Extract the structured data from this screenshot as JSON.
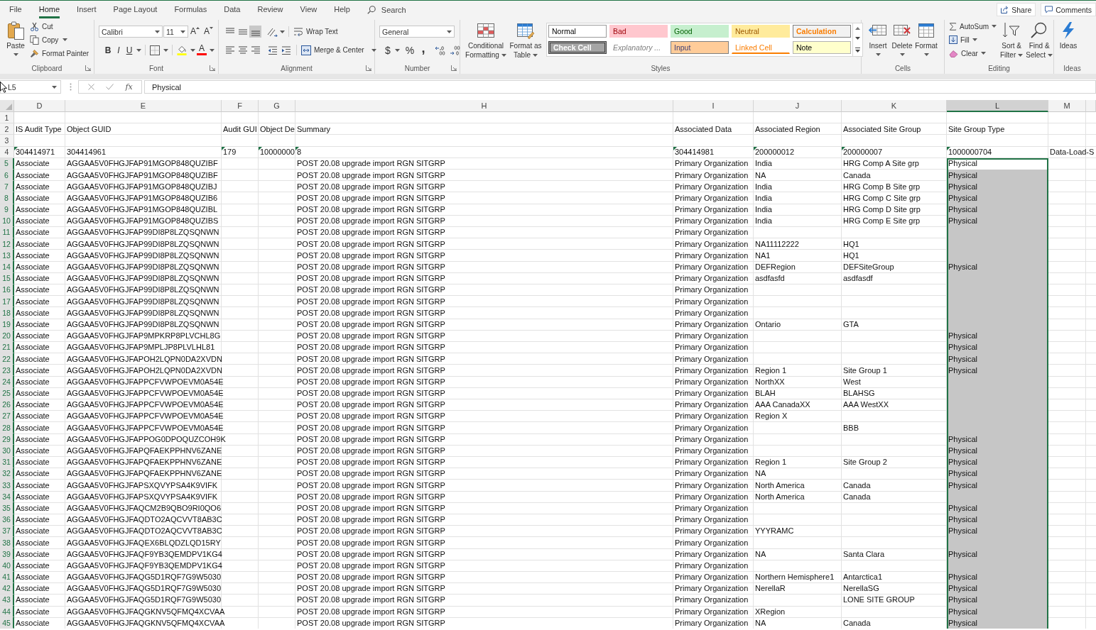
{
  "ribbon_tabs": [
    {
      "label": "File",
      "selected": false
    },
    {
      "label": "Home",
      "selected": true
    },
    {
      "label": "Insert",
      "selected": false
    },
    {
      "label": "Page Layout",
      "selected": false
    },
    {
      "label": "Formulas",
      "selected": false
    },
    {
      "label": "Data",
      "selected": false
    },
    {
      "label": "Review",
      "selected": false
    },
    {
      "label": "View",
      "selected": false
    },
    {
      "label": "Help",
      "selected": false
    }
  ],
  "search": {
    "placeholder": "Search"
  },
  "share_button": "Share",
  "comments_button": "Comments",
  "clipboard": {
    "label": "Clipboard",
    "launcher": true,
    "paste": "Paste",
    "cut": "Cut",
    "copy": "Copy",
    "format_painter": "Format Painter"
  },
  "font": {
    "label": "Font",
    "launcher": true,
    "font_name": "Calibri",
    "font_size": "11",
    "grow": "A",
    "shrink": "A",
    "bold": "B",
    "italic": "I",
    "underline": "U",
    "color_buttons": [
      {
        "kind": "fill",
        "color": "#ffff00"
      },
      {
        "kind": "text",
        "letter": "A",
        "color": "#ff0000"
      }
    ]
  },
  "alignment": {
    "label": "Alignment",
    "launcher": true,
    "vertical": [
      {
        "kind": "top",
        "selected": false
      },
      {
        "kind": "middle",
        "selected": false
      },
      {
        "kind": "bottom",
        "selected": true
      }
    ],
    "horizontal": [
      {
        "kind": "left",
        "selected": false
      },
      {
        "kind": "center",
        "selected": false
      },
      {
        "kind": "right",
        "selected": false
      }
    ],
    "wrap_text": "Wrap Text",
    "merge_center": "Merge & Center"
  },
  "number": {
    "label": "Number",
    "launcher": true,
    "format": "General",
    "currency": "$",
    "percent": "%",
    "comma": ","
  },
  "styles": {
    "label": "Styles",
    "conditional_formatting": "Conditional Formatting",
    "format_as_table": "Format as Table",
    "gallery": [
      {
        "label": "Normal",
        "kind": "normal",
        "color": "#ffffff"
      },
      {
        "label": "Bad",
        "kind": "bad",
        "color": "#ffc7ce"
      },
      {
        "label": "Good",
        "kind": "good",
        "color": "#c6efce"
      },
      {
        "label": "Neutral",
        "kind": "neutral",
        "color": "#ffeb9c"
      },
      {
        "label": "Calculation",
        "kind": "calculation",
        "color": "#f2f2f2"
      },
      {
        "label": "Check Cell",
        "kind": "check",
        "color": "#a5a5a5"
      },
      {
        "label": "Explanatory ...",
        "kind": "explanatory",
        "color": "#ffffff"
      },
      {
        "label": "Input",
        "kind": "input",
        "color": "#ffcc99"
      },
      {
        "label": "Linked Cell",
        "kind": "linked",
        "color": "#ffffff"
      },
      {
        "label": "Note",
        "kind": "note",
        "color": "#ffffcc"
      }
    ]
  },
  "cells": {
    "label": "Cells",
    "buttons": [
      {
        "label": "Insert",
        "kind": "insert"
      },
      {
        "label": "Delete",
        "kind": "delete"
      },
      {
        "label": "Format",
        "kind": "format"
      }
    ]
  },
  "editing": {
    "label": "Editing",
    "autosum": "AutoSum",
    "fill": "Fill",
    "clear": "Clear",
    "sort_filter": "Sort & Filter",
    "find_select": "Find & Select"
  },
  "ideas": {
    "label": "Ideas",
    "button": "Ideas"
  },
  "formula_bar": {
    "name_box": "L5",
    "insert_function": "fx",
    "formula": "Physical"
  },
  "sheet": {
    "columns": [
      {
        "letter": "D",
        "selected": false
      },
      {
        "letter": "E",
        "selected": false
      },
      {
        "letter": "F",
        "selected": false
      },
      {
        "letter": "G",
        "selected": false
      },
      {
        "letter": "H",
        "selected": false
      },
      {
        "letter": "I",
        "selected": false
      },
      {
        "letter": "J",
        "selected": false
      },
      {
        "letter": "K",
        "selected": false
      },
      {
        "letter": "L",
        "selected": true
      },
      {
        "letter": "M",
        "selected": false
      }
    ],
    "rows": [
      {
        "number": "1",
        "selected": false
      },
      {
        "number": "2",
        "selected": false,
        "is_audit_type": "IS Audit Type",
        "object_guid": "Object GUID",
        "audit_gui": "Audit GUI",
        "object_de": "Object De",
        "summary": "Summary",
        "associated_data": "Associated Data",
        "associated_region": "Associated Region",
        "associated_site_group": "Associated Site Group",
        "site_group_type": "Site Group Type"
      },
      {
        "number": "3",
        "selected": false
      },
      {
        "number": "4",
        "selected": false,
        "is_audit_type": "304414971",
        "object_guid": "304414961",
        "audit_gui": "179",
        "object_de": "10000000",
        "summary": "8",
        "associated_data": "304414981",
        "associated_region": "200000012",
        "associated_site_group": "200000007",
        "site_group_type": "1000000704",
        "column_10": "Data-Load-S",
        "flagged": {
          "is_audit_type": true,
          "object_guid": false,
          "audit_gui": true,
          "object_de": true,
          "summary": true,
          "associated_data": true,
          "associated_region": true,
          "associated_site_group": true,
          "site_group_type": true,
          "column_10": false
        }
      },
      {
        "number": "5",
        "selected": true,
        "is_audit_type": "Associate",
        "object_guid": "AGGAA5V0FHGJFAP91MGOP848QUZIBF",
        "summary": "POST 20.08 upgrade import RGN SITGRP",
        "associated_data": "Primary Organization",
        "associated_region": "India",
        "associated_site_group": "HRG Comp A Site grp",
        "site_group_type": "Physical"
      },
      {
        "number": "6",
        "selected": true,
        "is_audit_type": "Associate",
        "object_guid": "AGGAA5V0FHGJFAP91MGOP848QUZIBF",
        "summary": "POST 20.08 upgrade import RGN SITGRP",
        "associated_data": "Primary Organization",
        "associated_region": "NA",
        "associated_site_group": "Canada",
        "site_group_type": "Physical"
      },
      {
        "number": "7",
        "selected": true,
        "is_audit_type": "Associate",
        "object_guid": "AGGAA5V0FHGJFAP91MGOP848QUZIBJ",
        "summary": "POST 20.08 upgrade import RGN SITGRP",
        "associated_data": "Primary Organization",
        "associated_region": "India",
        "associated_site_group": "HRG Comp B Site grp",
        "site_group_type": "Physical"
      },
      {
        "number": "8",
        "selected": true,
        "is_audit_type": "Associate",
        "object_guid": "AGGAA5V0FHGJFAP91MGOP848QUZIB6",
        "summary": "POST 20.08 upgrade import RGN SITGRP",
        "associated_data": "Primary Organization",
        "associated_region": "India",
        "associated_site_group": "HRG Comp C Site grp",
        "site_group_type": "Physical"
      },
      {
        "number": "9",
        "selected": true,
        "is_audit_type": "Associate",
        "object_guid": "AGGAA5V0FHGJFAP91MGOP848QUZIBL",
        "summary": "POST 20.08 upgrade import RGN SITGRP",
        "associated_data": "Primary Organization",
        "associated_region": "India",
        "associated_site_group": "HRG Comp D Site grp",
        "site_group_type": "Physical"
      },
      {
        "number": "10",
        "selected": true,
        "is_audit_type": "Associate",
        "object_guid": "AGGAA5V0FHGJFAP91MGOP848QUZIBS",
        "summary": "POST 20.08 upgrade import RGN SITGRP",
        "associated_data": "Primary Organization",
        "associated_region": "India",
        "associated_site_group": "HRG Comp E Site grp",
        "site_group_type": "Physical"
      },
      {
        "number": "11",
        "selected": true,
        "is_audit_type": "Associate",
        "object_guid": "AGGAA5V0FHGJFAP99DI8P8LZQSQNWN",
        "summary": "POST 20.08 upgrade import RGN SITGRP",
        "associated_data": "Primary Organization"
      },
      {
        "number": "12",
        "selected": true,
        "is_audit_type": "Associate",
        "object_guid": "AGGAA5V0FHGJFAP99DI8P8LZQSQNWN",
        "summary": "POST 20.08 upgrade import RGN SITGRP",
        "associated_data": "Primary Organization",
        "associated_region": "NA11112222",
        "associated_site_group": "HQ1"
      },
      {
        "number": "13",
        "selected": true,
        "is_audit_type": "Associate",
        "object_guid": "AGGAA5V0FHGJFAP99DI8P8LZQSQNWN",
        "summary": "POST 20.08 upgrade import RGN SITGRP",
        "associated_data": "Primary Organization",
        "associated_region": "NA1",
        "associated_site_group": "HQ1"
      },
      {
        "number": "14",
        "selected": true,
        "is_audit_type": "Associate",
        "object_guid": "AGGAA5V0FHGJFAP99DI8P8LZQSQNWN",
        "summary": "POST 20.08 upgrade import RGN SITGRP",
        "associated_data": "Primary Organization",
        "associated_region": "DEFRegion",
        "associated_site_group": "DEFSiteGroup",
        "site_group_type": "Physical"
      },
      {
        "number": "15",
        "selected": true,
        "is_audit_type": "Associate",
        "object_guid": "AGGAA5V0FHGJFAP99DI8P8LZQSQNWN",
        "summary": "POST 20.08 upgrade import RGN SITGRP",
        "associated_data": "Primary Organization",
        "associated_region": "asdfasfd",
        "associated_site_group": "asdfasdf"
      },
      {
        "number": "16",
        "selected": true,
        "is_audit_type": "Associate",
        "object_guid": "AGGAA5V0FHGJFAP99DI8P8LZQSQNWN",
        "summary": "POST 20.08 upgrade import RGN SITGRP",
        "associated_data": "Primary Organization"
      },
      {
        "number": "17",
        "selected": true,
        "is_audit_type": "Associate",
        "object_guid": "AGGAA5V0FHGJFAP99DI8P8LZQSQNWN",
        "summary": "POST 20.08 upgrade import RGN SITGRP",
        "associated_data": "Primary Organization"
      },
      {
        "number": "18",
        "selected": true,
        "is_audit_type": "Associate",
        "object_guid": "AGGAA5V0FHGJFAP99DI8P8LZQSQNWN",
        "summary": "POST 20.08 upgrade import RGN SITGRP",
        "associated_data": "Primary Organization"
      },
      {
        "number": "19",
        "selected": true,
        "is_audit_type": "Associate",
        "object_guid": "AGGAA5V0FHGJFAP99DI8P8LZQSQNWN",
        "summary": "POST 20.08 upgrade import RGN SITGRP",
        "associated_data": "Primary Organization",
        "associated_region": "Ontario",
        "associated_site_group": "GTA"
      },
      {
        "number": "20",
        "selected": true,
        "is_audit_type": "Associate",
        "object_guid": "AGGAA5V0FHGJFAP9MPKRP8PLVCHL8G",
        "summary": "POST 20.08 upgrade import RGN SITGRP",
        "associated_data": "Primary Organization",
        "site_group_type": "Physical"
      },
      {
        "number": "21",
        "selected": true,
        "is_audit_type": "Associate",
        "object_guid": "AGGAA5V0FHGJFAP9MPLJP8PLVLHL81",
        "summary": "POST 20.08 upgrade import RGN SITGRP",
        "associated_data": "Primary Organization",
        "site_group_type": "Physical"
      },
      {
        "number": "22",
        "selected": true,
        "is_audit_type": "Associate",
        "object_guid": "AGGAA5V0FHGJFAPOH2LQPN0DA2XVDN",
        "summary": "POST 20.08 upgrade import RGN SITGRP",
        "associated_data": "Primary Organization",
        "site_group_type": "Physical"
      },
      {
        "number": "23",
        "selected": true,
        "is_audit_type": "Associate",
        "object_guid": "AGGAA5V0FHGJFAPOH2LQPN0DA2XVDN",
        "summary": "POST 20.08 upgrade import RGN SITGRP",
        "associated_data": "Primary Organization",
        "associated_region": "Region 1",
        "associated_site_group": "Site Group 1",
        "site_group_type": "Physical"
      },
      {
        "number": "24",
        "selected": true,
        "is_audit_type": "Associate",
        "object_guid": "AGGAA5V0FHGJFAPPCFVWPOEVM0A54E",
        "summary": "POST 20.08 upgrade import RGN SITGRP",
        "associated_data": "Primary Organization",
        "associated_region": "NorthXX",
        "associated_site_group": "West"
      },
      {
        "number": "25",
        "selected": true,
        "is_audit_type": "Associate",
        "object_guid": "AGGAA5V0FHGJFAPPCFVWPOEVM0A54E",
        "summary": "POST 20.08 upgrade import RGN SITGRP",
        "associated_data": "Primary Organization",
        "associated_region": "BLAH",
        "associated_site_group": "BLAHSG"
      },
      {
        "number": "26",
        "selected": true,
        "is_audit_type": "Associate",
        "object_guid": "AGGAA5V0FHGJFAPPCFVWPOEVM0A54E",
        "summary": "POST 20.08 upgrade import RGN SITGRP",
        "associated_data": "Primary Organization",
        "associated_region": "AAA CanadaXX",
        "associated_site_group": "AAA WestXX"
      },
      {
        "number": "27",
        "selected": true,
        "is_audit_type": "Associate",
        "object_guid": "AGGAA5V0FHGJFAPPCFVWPOEVM0A54E",
        "summary": "POST 20.08 upgrade import RGN SITGRP",
        "associated_data": "Primary Organization",
        "associated_region": "Region X"
      },
      {
        "number": "28",
        "selected": true,
        "is_audit_type": "Associate",
        "object_guid": "AGGAA5V0FHGJFAPPCFVWPOEVM0A54E",
        "summary": "POST 20.08 upgrade import RGN SITGRP",
        "associated_data": "Primary Organization",
        "associated_site_group": "BBB"
      },
      {
        "number": "29",
        "selected": true,
        "is_audit_type": "Associate",
        "object_guid": "AGGAA5V0FHGJFAPPOG0DPOQUZCOH9K",
        "summary": "POST 20.08 upgrade import RGN SITGRP",
        "associated_data": "Primary Organization",
        "site_group_type": "Physical"
      },
      {
        "number": "30",
        "selected": true,
        "is_audit_type": "Associate",
        "object_guid": "AGGAA5V0FHGJFAPQFAEKPPHNV6ZANE",
        "summary": "POST 20.08 upgrade import RGN SITGRP",
        "associated_data": "Primary Organization",
        "site_group_type": "Physical"
      },
      {
        "number": "31",
        "selected": true,
        "is_audit_type": "Associate",
        "object_guid": "AGGAA5V0FHGJFAPQFAEKPPHNV6ZANE",
        "summary": "POST 20.08 upgrade import RGN SITGRP",
        "associated_data": "Primary Organization",
        "associated_region": "Region 1",
        "associated_site_group": "Site Group 2",
        "site_group_type": "Physical"
      },
      {
        "number": "32",
        "selected": true,
        "is_audit_type": "Associate",
        "object_guid": "AGGAA5V0FHGJFAPQFAEKPPHNV6ZANE",
        "summary": "POST 20.08 upgrade import RGN SITGRP",
        "associated_data": "Primary Organization",
        "associated_region": "NA",
        "site_group_type": "Physical"
      },
      {
        "number": "33",
        "selected": true,
        "is_audit_type": "Associate",
        "object_guid": "AGGAA5V0FHGJFAPSXQVYPSA4K9VIFK",
        "summary": "POST 20.08 upgrade import RGN SITGRP",
        "associated_data": "Primary Organization",
        "associated_region": "North America",
        "associated_site_group": "Canada",
        "site_group_type": "Physical"
      },
      {
        "number": "34",
        "selected": true,
        "is_audit_type": "Associate",
        "object_guid": "AGGAA5V0FHGJFAPSXQVYPSA4K9VIFK",
        "summary": "POST 20.08 upgrade import RGN SITGRP",
        "associated_data": "Primary Organization",
        "associated_region": "North America",
        "associated_site_group": "Canada"
      },
      {
        "number": "35",
        "selected": true,
        "is_audit_type": "Associate",
        "object_guid": "AGGAA5V0FHGJFAQCM2B9QBO9RI0QO6",
        "summary": "POST 20.08 upgrade import RGN SITGRP",
        "associated_data": "Primary Organization",
        "site_group_type": "Physical"
      },
      {
        "number": "36",
        "selected": true,
        "is_audit_type": "Associate",
        "object_guid": "AGGAA5V0FHGJFAQDTO2AQCVVT8AB3C",
        "summary": "POST 20.08 upgrade import RGN SITGRP",
        "associated_data": "Primary Organization",
        "site_group_type": "Physical"
      },
      {
        "number": "37",
        "selected": true,
        "is_audit_type": "Associate",
        "object_guid": "AGGAA5V0FHGJFAQDTO2AQCVVT8AB3C",
        "summary": "POST 20.08 upgrade import RGN SITGRP",
        "associated_data": "Primary Organization",
        "associated_region": "YYYRAMC",
        "site_group_type": "Physical"
      },
      {
        "number": "38",
        "selected": true,
        "is_audit_type": "Associate",
        "object_guid": "AGGAA5V0FHGJFAQEX6BLQDZLQD15RY",
        "summary": "POST 20.08 upgrade import RGN SITGRP",
        "associated_data": "Primary Organization"
      },
      {
        "number": "39",
        "selected": true,
        "is_audit_type": "Associate",
        "object_guid": "AGGAA5V0FHGJFAQF9YB3QEMDPV1KG4",
        "summary": "POST 20.08 upgrade import RGN SITGRP",
        "associated_data": "Primary Organization",
        "associated_region": "NA",
        "associated_site_group": "Santa Clara",
        "site_group_type": "Physical"
      },
      {
        "number": "40",
        "selected": true,
        "is_audit_type": "Associate",
        "object_guid": "AGGAA5V0FHGJFAQF9YB3QEMDPV1KG4",
        "summary": "POST 20.08 upgrade import RGN SITGRP",
        "associated_data": "Primary Organization"
      },
      {
        "number": "41",
        "selected": true,
        "is_audit_type": "Associate",
        "object_guid": "AGGAA5V0FHGJFAQG5D1RQF7G9W5030",
        "summary": "POST 20.08 upgrade import RGN SITGRP",
        "associated_data": "Primary Organization",
        "associated_region": "Northern Hemisphere1",
        "associated_site_group": "Antarctica1",
        "site_group_type": "Physical"
      },
      {
        "number": "42",
        "selected": true,
        "is_audit_type": "Associate",
        "object_guid": "AGGAA5V0FHGJFAQG5D1RQF7G9W5030",
        "summary": "POST 20.08 upgrade import RGN SITGRP",
        "associated_data": "Primary Organization",
        "associated_region": "NerellaR",
        "associated_site_group": "NerellaSG",
        "site_group_type": "Physical"
      },
      {
        "number": "43",
        "selected": true,
        "is_audit_type": "Associate",
        "object_guid": "AGGAA5V0FHGJFAQG5D1RQF7G9W5030",
        "summary": "POST 20.08 upgrade import RGN SITGRP",
        "associated_data": "Primary Organization",
        "associated_site_group": "LONE SITE GROUP",
        "site_group_type": "Physical"
      },
      {
        "number": "44",
        "selected": true,
        "is_audit_type": "Associate",
        "object_guid": "AGGAA5V0FHGJFAQGKNV5QFMQ4XCVAA",
        "summary": "POST 20.08 upgrade import RGN SITGRP",
        "associated_data": "Primary Organization",
        "associated_region": "XRegion",
        "site_group_type": "Physical"
      },
      {
        "number": "45",
        "selected": true,
        "is_audit_type": "Associate",
        "object_guid": "AGGAA5V0FHGJFAQGKNV5QFMQ4XCVAA",
        "summary": "POST 20.08 upgrade import RGN SITGRP",
        "associated_data": "Primary Organization",
        "associated_region": "NA",
        "associated_site_group": "Canada",
        "site_group_type": "Physical"
      }
    ]
  }
}
